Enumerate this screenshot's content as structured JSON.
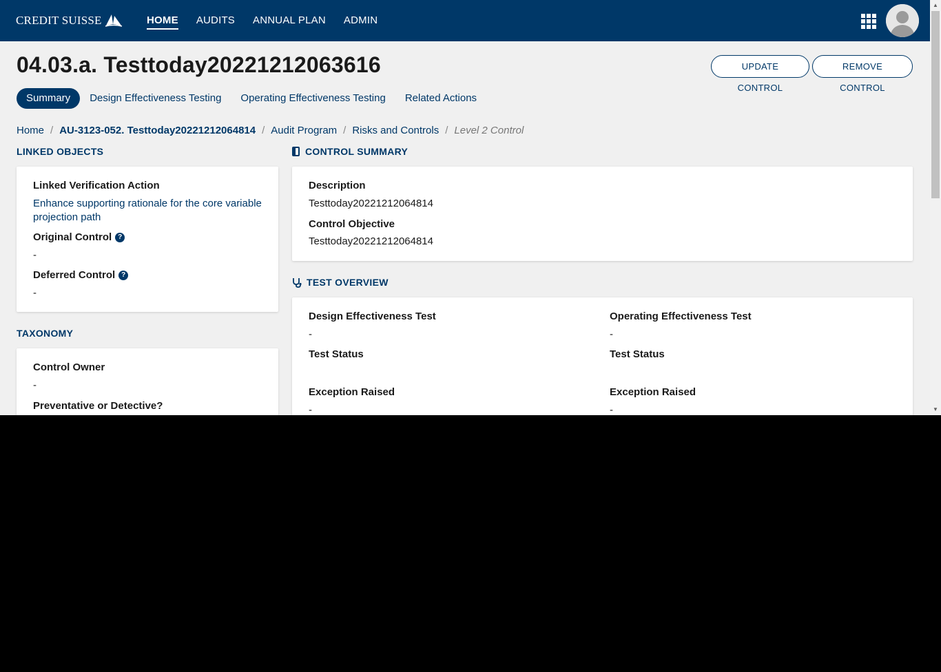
{
  "brand": {
    "name": "CREDIT SUISSE"
  },
  "nav": {
    "items": [
      {
        "label": "HOME",
        "active": true
      },
      {
        "label": "AUDITS",
        "active": false
      },
      {
        "label": "ANNUAL PLAN",
        "active": false
      },
      {
        "label": "ADMIN",
        "active": false
      }
    ],
    "apps_icon": "apps-grid-icon",
    "avatar_icon": "user-avatar-icon"
  },
  "page": {
    "title": "04.03.a. Testtoday20221212063616",
    "buttons": {
      "update": "UPDATE CONTROL",
      "remove": "REMOVE CONTROL"
    },
    "tabs": [
      {
        "label": "Summary",
        "active": true
      },
      {
        "label": "Design Effectiveness Testing",
        "active": false
      },
      {
        "label": "Operating Effectiveness Testing",
        "active": false
      },
      {
        "label": "Related Actions",
        "active": false
      }
    ],
    "breadcrumb": [
      {
        "label": "Home"
      },
      {
        "label": "AU-3123-052. Testtoday20221212064814"
      },
      {
        "label": "Audit Program"
      },
      {
        "label": "Risks and Controls"
      },
      {
        "label": "Level 2 Control"
      }
    ]
  },
  "linked_objects": {
    "heading": "LINKED OBJECTS",
    "linked_verification_action_label": "Linked Verification Action",
    "linked_verification_action_value": "Enhance supporting rationale for the core variable projection path",
    "original_control_label": "Original Control",
    "original_control_value": "-",
    "deferred_control_label": "Deferred Control",
    "deferred_control_value": "-"
  },
  "taxonomy": {
    "heading": "TAXONOMY",
    "control_owner_label": "Control Owner",
    "control_owner_value": "-",
    "preventative_label": "Preventative or Detective?"
  },
  "control_summary": {
    "heading": "CONTROL SUMMARY",
    "description_label": "Description",
    "description_value": "Testtoday20221212064814",
    "objective_label": "Control Objective",
    "objective_value": "Testtoday20221212064814"
  },
  "test_overview": {
    "heading": "TEST OVERVIEW",
    "design": {
      "test_label": "Design Effectiveness Test",
      "test_value": "-",
      "status_label": "Test Status",
      "status_value": "",
      "exception_label": "Exception Raised",
      "exception_value": "-"
    },
    "operating": {
      "test_label": "Operating Effectiveness Test",
      "test_value": "-",
      "status_label": "Test Status",
      "status_value": "",
      "exception_label": "Exception Raised",
      "exception_value": "-"
    }
  },
  "colors": {
    "primary": "#003868",
    "background": "#f0f0f0",
    "card": "#ffffff"
  }
}
